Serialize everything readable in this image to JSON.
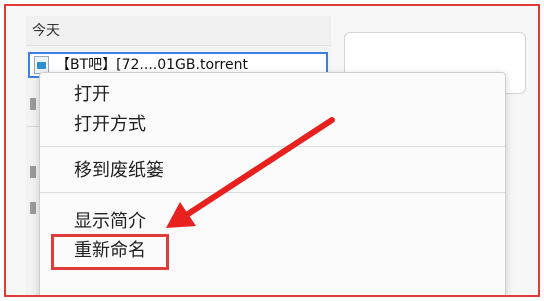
{
  "sidebar": {
    "section_header": "今天",
    "file_row": {
      "name": "【BT吧】[72....01GB.torrent",
      "icon": "torrent-file-icon"
    }
  },
  "context_menu": {
    "items": [
      {
        "label": "打开"
      },
      {
        "label": "打开方式"
      },
      {
        "label": "移到废纸篓"
      },
      {
        "label": "显示简介"
      },
      {
        "label": "重新命名"
      }
    ]
  },
  "annotation": {
    "highlight_color": "#e03c3c",
    "arrow_color": "#e8211f",
    "highlighted_item": "重新命名"
  },
  "colors": {
    "selection_border": "#3d7fe0",
    "frame_border": "#e03c3c"
  }
}
